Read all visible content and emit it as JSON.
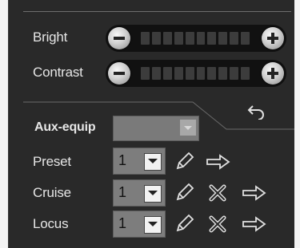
{
  "bright": {
    "label": "Bright",
    "minus_icon": "minus-circle-icon",
    "plus_icon": "plus-circle-icon",
    "level": 0
  },
  "contrast": {
    "label": "Contrast",
    "minus_icon": "minus-circle-icon",
    "plus_icon": "plus-circle-icon",
    "level": 0
  },
  "undo_icon": "undo-arrow-icon",
  "aux_equip": {
    "label": "Aux-equip",
    "value": ""
  },
  "preset": {
    "label": "Preset",
    "value": "1",
    "actions": [
      "pencil-icon",
      "right-arrow-icon"
    ]
  },
  "cruise": {
    "label": "Cruise",
    "value": "1",
    "actions": [
      "pencil-icon",
      "delete-x-icon",
      "right-arrow-icon"
    ]
  },
  "locus": {
    "label": "Locus",
    "value": "1",
    "actions": [
      "pencil-icon",
      "delete-x-icon",
      "right-arrow-icon"
    ]
  },
  "colors": {
    "panel": "#292929",
    "text": "#e6e6e6",
    "slider": "#111111",
    "select": "#7d7d7d"
  }
}
